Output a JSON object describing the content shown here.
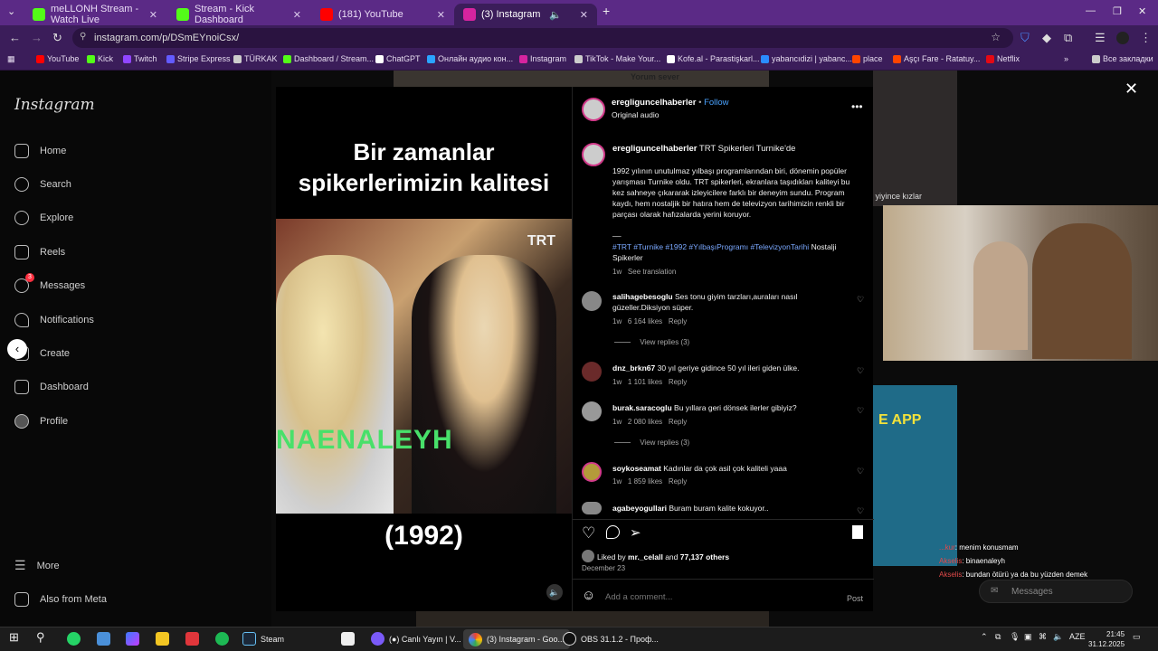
{
  "tabs": [
    {
      "title": "meLLONH Stream - Watch Live",
      "color": "#53fc18"
    },
    {
      "title": "Stream - Kick Dashboard",
      "color": "#53fc18"
    },
    {
      "title": "(181) YouTube",
      "color": "#ff0000"
    },
    {
      "title": "(3) Instagram",
      "color": "#d6249f"
    }
  ],
  "address": {
    "url": "instagram.com/p/DSmEYnoiCsx/"
  },
  "bookmarks": [
    {
      "label": "YouTube",
      "color": "#ff0000"
    },
    {
      "label": "Kick",
      "color": "#53fc18"
    },
    {
      "label": "Twitch",
      "color": "#9146ff"
    },
    {
      "label": "Stripe Express",
      "color": "#635bff"
    },
    {
      "label": "TÜRKAK",
      "color": "#cccccc"
    },
    {
      "label": "Dashboard / Stream...",
      "color": "#53fc18"
    },
    {
      "label": "ChatGPT",
      "color": "#ffffff"
    },
    {
      "label": "Онлайн аудио кон...",
      "color": "#2aa4ff"
    },
    {
      "label": "Instagram",
      "color": "#d6249f"
    },
    {
      "label": "TikTok - Make Your...",
      "color": "#cccccc"
    },
    {
      "label": "Kofe.al - Parastişkarl...",
      "color": "#ffffff"
    },
    {
      "label": "yabancıdizi | yabanc...",
      "color": "#2a8cff"
    },
    {
      "label": "place",
      "color": "#ff4500"
    },
    {
      "label": "Aşçı Fare - Ratatuy...",
      "color": "#ff4500"
    },
    {
      "label": "Netflix",
      "color": "#e50914"
    },
    {
      "label": "Все закладки",
      "color": "#cccccc"
    }
  ],
  "sidebar": {
    "logo": "Instagram",
    "items": [
      {
        "label": "Home"
      },
      {
        "label": "Search"
      },
      {
        "label": "Explore"
      },
      {
        "label": "Reels"
      },
      {
        "label": "Messages",
        "badge": "3"
      },
      {
        "label": "Notifications"
      },
      {
        "label": "Create"
      },
      {
        "label": "Dashboard"
      },
      {
        "label": "Profile"
      }
    ],
    "more": "More",
    "meta": "Also from Meta"
  },
  "video": {
    "title_line1": "Bir zamanlar",
    "title_line2": "spikerlerimizin kalitesi",
    "channel": "TRT",
    "nameband": "NAENALEYH",
    "year": "(1992)"
  },
  "post": {
    "username": "eregliguncelhaberler",
    "follow": "Follow",
    "audio": "Original audio",
    "caption_user": "eregliguncelhaberler",
    "caption_title": "TRT Spikerleri Turnike'de",
    "caption_body": "1992 yılının unutulmaz yılbaşı programlarından biri, dönemin popüler yarışması Turnike oldu. TRT spikerleri, ekranlara taşıdıkları kaliteyi bu kez sahneye çıkararak izleyicilere farklı bir deneyim sundu. Program kaydı, hem nostaljik bir hatıra hem de televizyon tarihimizin renkli bir parçası olarak hafızalarda yerini koruyor.",
    "caption_sep": "__",
    "hashtags": "#TRT #Turnike #1992 #YılbaşıProgramı #TelevizyonTarihi",
    "caption_tail": "Nostalji Spikerler",
    "caption_time": "1w",
    "see_translation": "See translation",
    "comments": [
      {
        "user": "salihagebesoglu",
        "text": "Ses tonu giyim tarzları,auraları nasıl güzeller.Diksiyon süper.",
        "time": "1w",
        "likes": "6 164 likes",
        "reply": "Reply",
        "replies": "View replies (3)"
      },
      {
        "user": "dnz_brkn67",
        "text": "30 yıl geriye gidince 50 yıl ileri giden ülke.",
        "time": "1w",
        "likes": "1 101 likes",
        "reply": "Reply",
        "replies": ""
      },
      {
        "user": "burak.saracoglu",
        "text": "Bu yıllara geri dönsek ilerler gibiyiz?",
        "time": "1w",
        "likes": "2 080 likes",
        "reply": "Reply",
        "replies": "View replies (3)"
      },
      {
        "user": "soykoseamat",
        "text": "Kadınlar da çok asil çok kaliteli yaaa",
        "time": "1w",
        "likes": "1 859 likes",
        "reply": "Reply",
        "replies": ""
      },
      {
        "user": "agabeyogullari",
        "text": "Buram buram kalite kokuyor..",
        "time": "",
        "likes": "",
        "reply": "",
        "replies": ""
      }
    ],
    "liked_by_prefix": "Liked by",
    "liked_by_user": "mr._celall",
    "liked_by_suffix": "and",
    "liked_by_count": "77,137 others",
    "date": "December 23",
    "add_comment_placeholder": "Add a comment...",
    "post_button": "Post"
  },
  "bg": {
    "top_label": "Yorum sever",
    "right_label": "n yiyince kızlar",
    "app_label": "E APP"
  },
  "overlay_chat": [
    {
      "name": "...kur",
      "text": "menim konusmam"
    },
    {
      "name": "Akselis",
      "text": "binaenaleyh"
    },
    {
      "name": "Akselis",
      "text": "bundan ötürü ya da bu yüzden demek"
    }
  ],
  "messages_pill": "Messages",
  "taskbar": {
    "items": [
      {
        "label": "Steam"
      },
      {
        "label": "(●) Canlı Yayın | V..."
      },
      {
        "label": "(3) Instagram - Goo..."
      },
      {
        "label": "OBS 31.1.2 - Проф..."
      }
    ],
    "lang": "AZE",
    "time": "21:45",
    "date": "31.12.2025"
  }
}
